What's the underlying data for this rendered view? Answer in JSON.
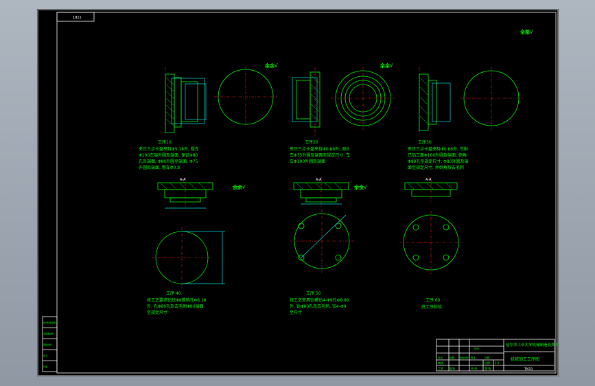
{
  "drawing": {
    "corner_tag": "1911",
    "roughness_mark": "全部√",
    "op_10": {
      "title": "工序10",
      "text": [
        "夹正三点卡盘夹持Φ5.18外, 粗车",
        "Φ100左端外圆及端面, 保证Φ80",
        "孔及端面, Φ80外圆至端面, Φ75",
        "外圆及端面, 粗车Φ0.8"
      ],
      "mark": "余余√"
    },
    "op_20": {
      "title": "工序20",
      "text": [
        "夹正三点卡盘夹持Φ0.88外, 调头",
        "车Φ75外圆及端面至规定尺寸, 车",
        "车Φ100外圆及端面"
      ],
      "mark": "余余√"
    },
    "op_30": {
      "title": "工序30",
      "text": [
        "夹正三点卡盘夹持Φ0.88外, 车削",
        "已加工面Φ100外圆及端面, 倒角",
        "Φ80孔至规定尺寸, Φ80外圆及端",
        "面至规定尺寸, 并倒角及去毛刺"
      ],
      "mark": ""
    },
    "op_40": {
      "title": "工序 40",
      "text": [
        "按工艺要求钻铰Φ8锥销孔Φ8.18",
        "外, 孔Φ80孔及去毛刺Φ80端面",
        "至规定尺寸"
      ],
      "mark": "余余√"
    },
    "op_50": {
      "title": "工序 50",
      "text": [
        "按工艺夹具钻模钻4-Φ9孔Φ8.80",
        "外, 钻Φ80孔及去毛刺, 铰4-Φ9",
        "至尺寸"
      ],
      "mark": "余余√"
    },
    "op_60": {
      "title": "工序 60",
      "text": [
        "终工序检验"
      ],
      "mark": ""
    },
    "section_labels": [
      "A-A",
      "A-A",
      "A-A"
    ]
  },
  "title_block": {
    "school": "哈尔滨工业大学机械制造及其自动化",
    "drawing_name": "机械加工工序图",
    "code": "TK01",
    "row_labels": [
      "标记",
      "处数",
      "更改文件号",
      "签字",
      "日期"
    ],
    "fields": [
      "设计",
      "审核",
      "工艺",
      "批准",
      "比例",
      "1:1",
      "共 张",
      "第 张"
    ]
  },
  "left_strip": {
    "labels": [
      "借(通)用件登记",
      "旧底图总号",
      "底图总号",
      "签字",
      "日期"
    ]
  },
  "colors": {
    "sheet": "#000000",
    "outline": "#00ff00",
    "centerline": "#ff2020",
    "dimension": "#00e5e5",
    "frame": "#ffffff",
    "viewport": "#a9b1bb"
  }
}
